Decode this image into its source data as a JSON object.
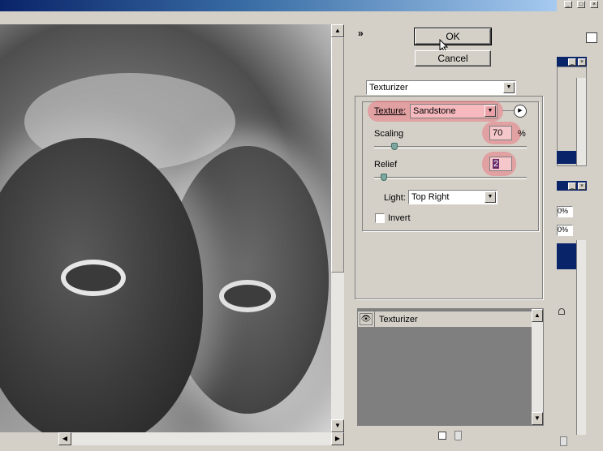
{
  "dialog": {
    "collapse_glyph": "»",
    "ok_label": "OK",
    "cancel_label": "Cancel"
  },
  "filter": {
    "selected": "Texturizer"
  },
  "texture": {
    "label": "Texture:",
    "value": "Sandstone",
    "menu_glyph": "▶"
  },
  "scaling": {
    "label": "Scaling",
    "value": "70",
    "unit": "%",
    "level_percent": 70
  },
  "relief": {
    "label": "Relief",
    "value": "2",
    "level_fraction": 0.04
  },
  "light": {
    "label": "Light:",
    "value": "Top Right"
  },
  "invert": {
    "label": "Invert",
    "checked": false
  },
  "effects_list": {
    "items": [
      {
        "label": "Texturizer"
      }
    ]
  },
  "right_panel": {
    "field1": "0%",
    "field2": "0%"
  },
  "colors": {
    "highlight": "#eb7882",
    "titlebar": "#0a246a",
    "dialog_bg": "#d4d0c8"
  }
}
